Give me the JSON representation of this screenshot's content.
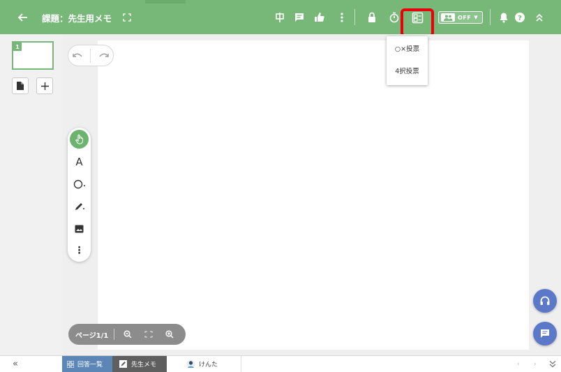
{
  "header": {
    "title": "課題：先生用メモ",
    "toggle_label": "OFF",
    "icons": [
      "back-arrow-icon",
      "fullscreen-icon",
      "chinese-char-icon",
      "comment-icon",
      "thumbs-up-icon",
      "more-vert-icon",
      "lock-icon",
      "timer-icon",
      "vote-icon",
      "group-icon",
      "bell-icon",
      "help-icon",
      "collapse-up-icon"
    ]
  },
  "dropdown": {
    "items": [
      "○×投票",
      "4択投票"
    ]
  },
  "pages": {
    "current_thumb_number": "1"
  },
  "canvas_tools": {
    "text_tool_label": "A",
    "more_label": "⋮"
  },
  "zoom": {
    "page_label": "ページ1/1"
  },
  "bottom_tabs": {
    "answers": "回答一覧",
    "memo": "先生メモ",
    "user": "けんた"
  },
  "colors": {
    "toolbar_green": "#77b879",
    "highlight_red": "#e8000b",
    "fab_blue": "#5b78c9",
    "answers_tab_blue": "#5b86b5",
    "memo_tab_gray": "#5f5f5f"
  }
}
